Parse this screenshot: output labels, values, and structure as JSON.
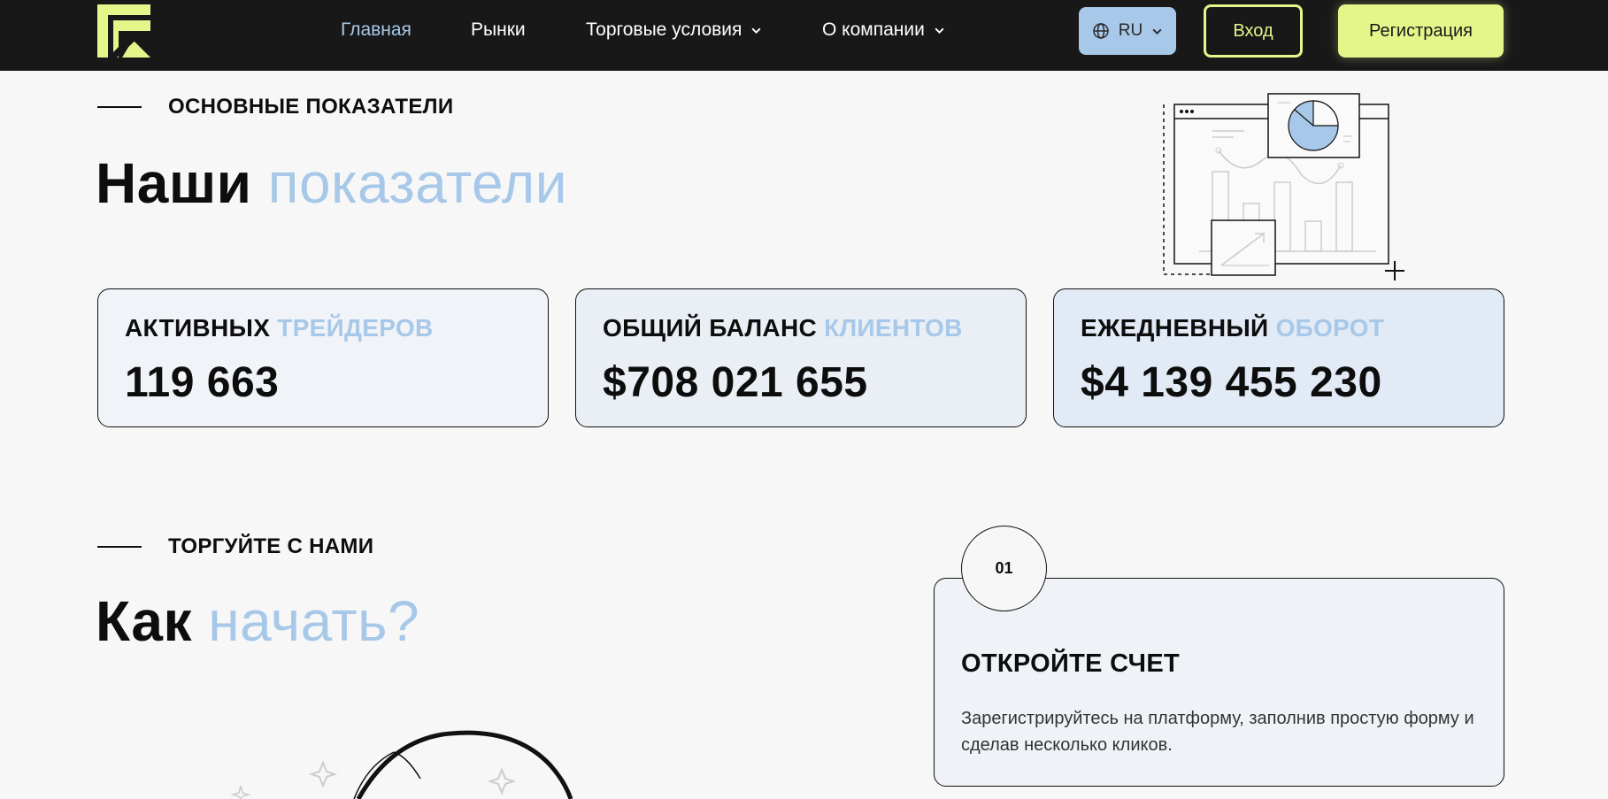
{
  "header": {
    "nav": [
      {
        "label": "Главная",
        "active": true,
        "dropdown": false
      },
      {
        "label": "Рынки",
        "active": false,
        "dropdown": false
      },
      {
        "label": "Торговые условия",
        "active": false,
        "dropdown": true
      },
      {
        "label": "О компании",
        "active": false,
        "dropdown": true
      }
    ],
    "language": "RU",
    "login_label": "Вход",
    "register_label": "Регистрация"
  },
  "stats_section": {
    "eyebrow": "ОСНОВНЫЕ ПОКАЗАТЕЛИ",
    "title_main": "Наши",
    "title_accent": "показатели",
    "cards": [
      {
        "label_main": "АКТИВНЫХ",
        "label_accent": "ТРЕЙДЕРОВ",
        "value": "119 663"
      },
      {
        "label_main": "ОБЩИЙ БАЛАНС",
        "label_accent": "КЛИЕНТОВ",
        "value": "$708 021 655"
      },
      {
        "label_main": "ЕЖЕДНЕВНЫЙ",
        "label_accent": "ОБОРОТ",
        "value": "$4 139 455 230"
      }
    ]
  },
  "start_section": {
    "eyebrow": "ТОРГУЙТЕ С НАМИ",
    "title_main": "Как",
    "title_accent": "начать?",
    "step": {
      "number": "01",
      "title": "ОТКРОЙТЕ СЧЕТ",
      "description": "Зарегистрируйтесь на платформу, заполнив простую форму и сделав несколько кликов."
    }
  },
  "colors": {
    "header_bg": "#181818",
    "accent_blue": "#a7c8e8",
    "accent_lime": "#e4f58a",
    "page_bg": "#f7f7f7"
  }
}
